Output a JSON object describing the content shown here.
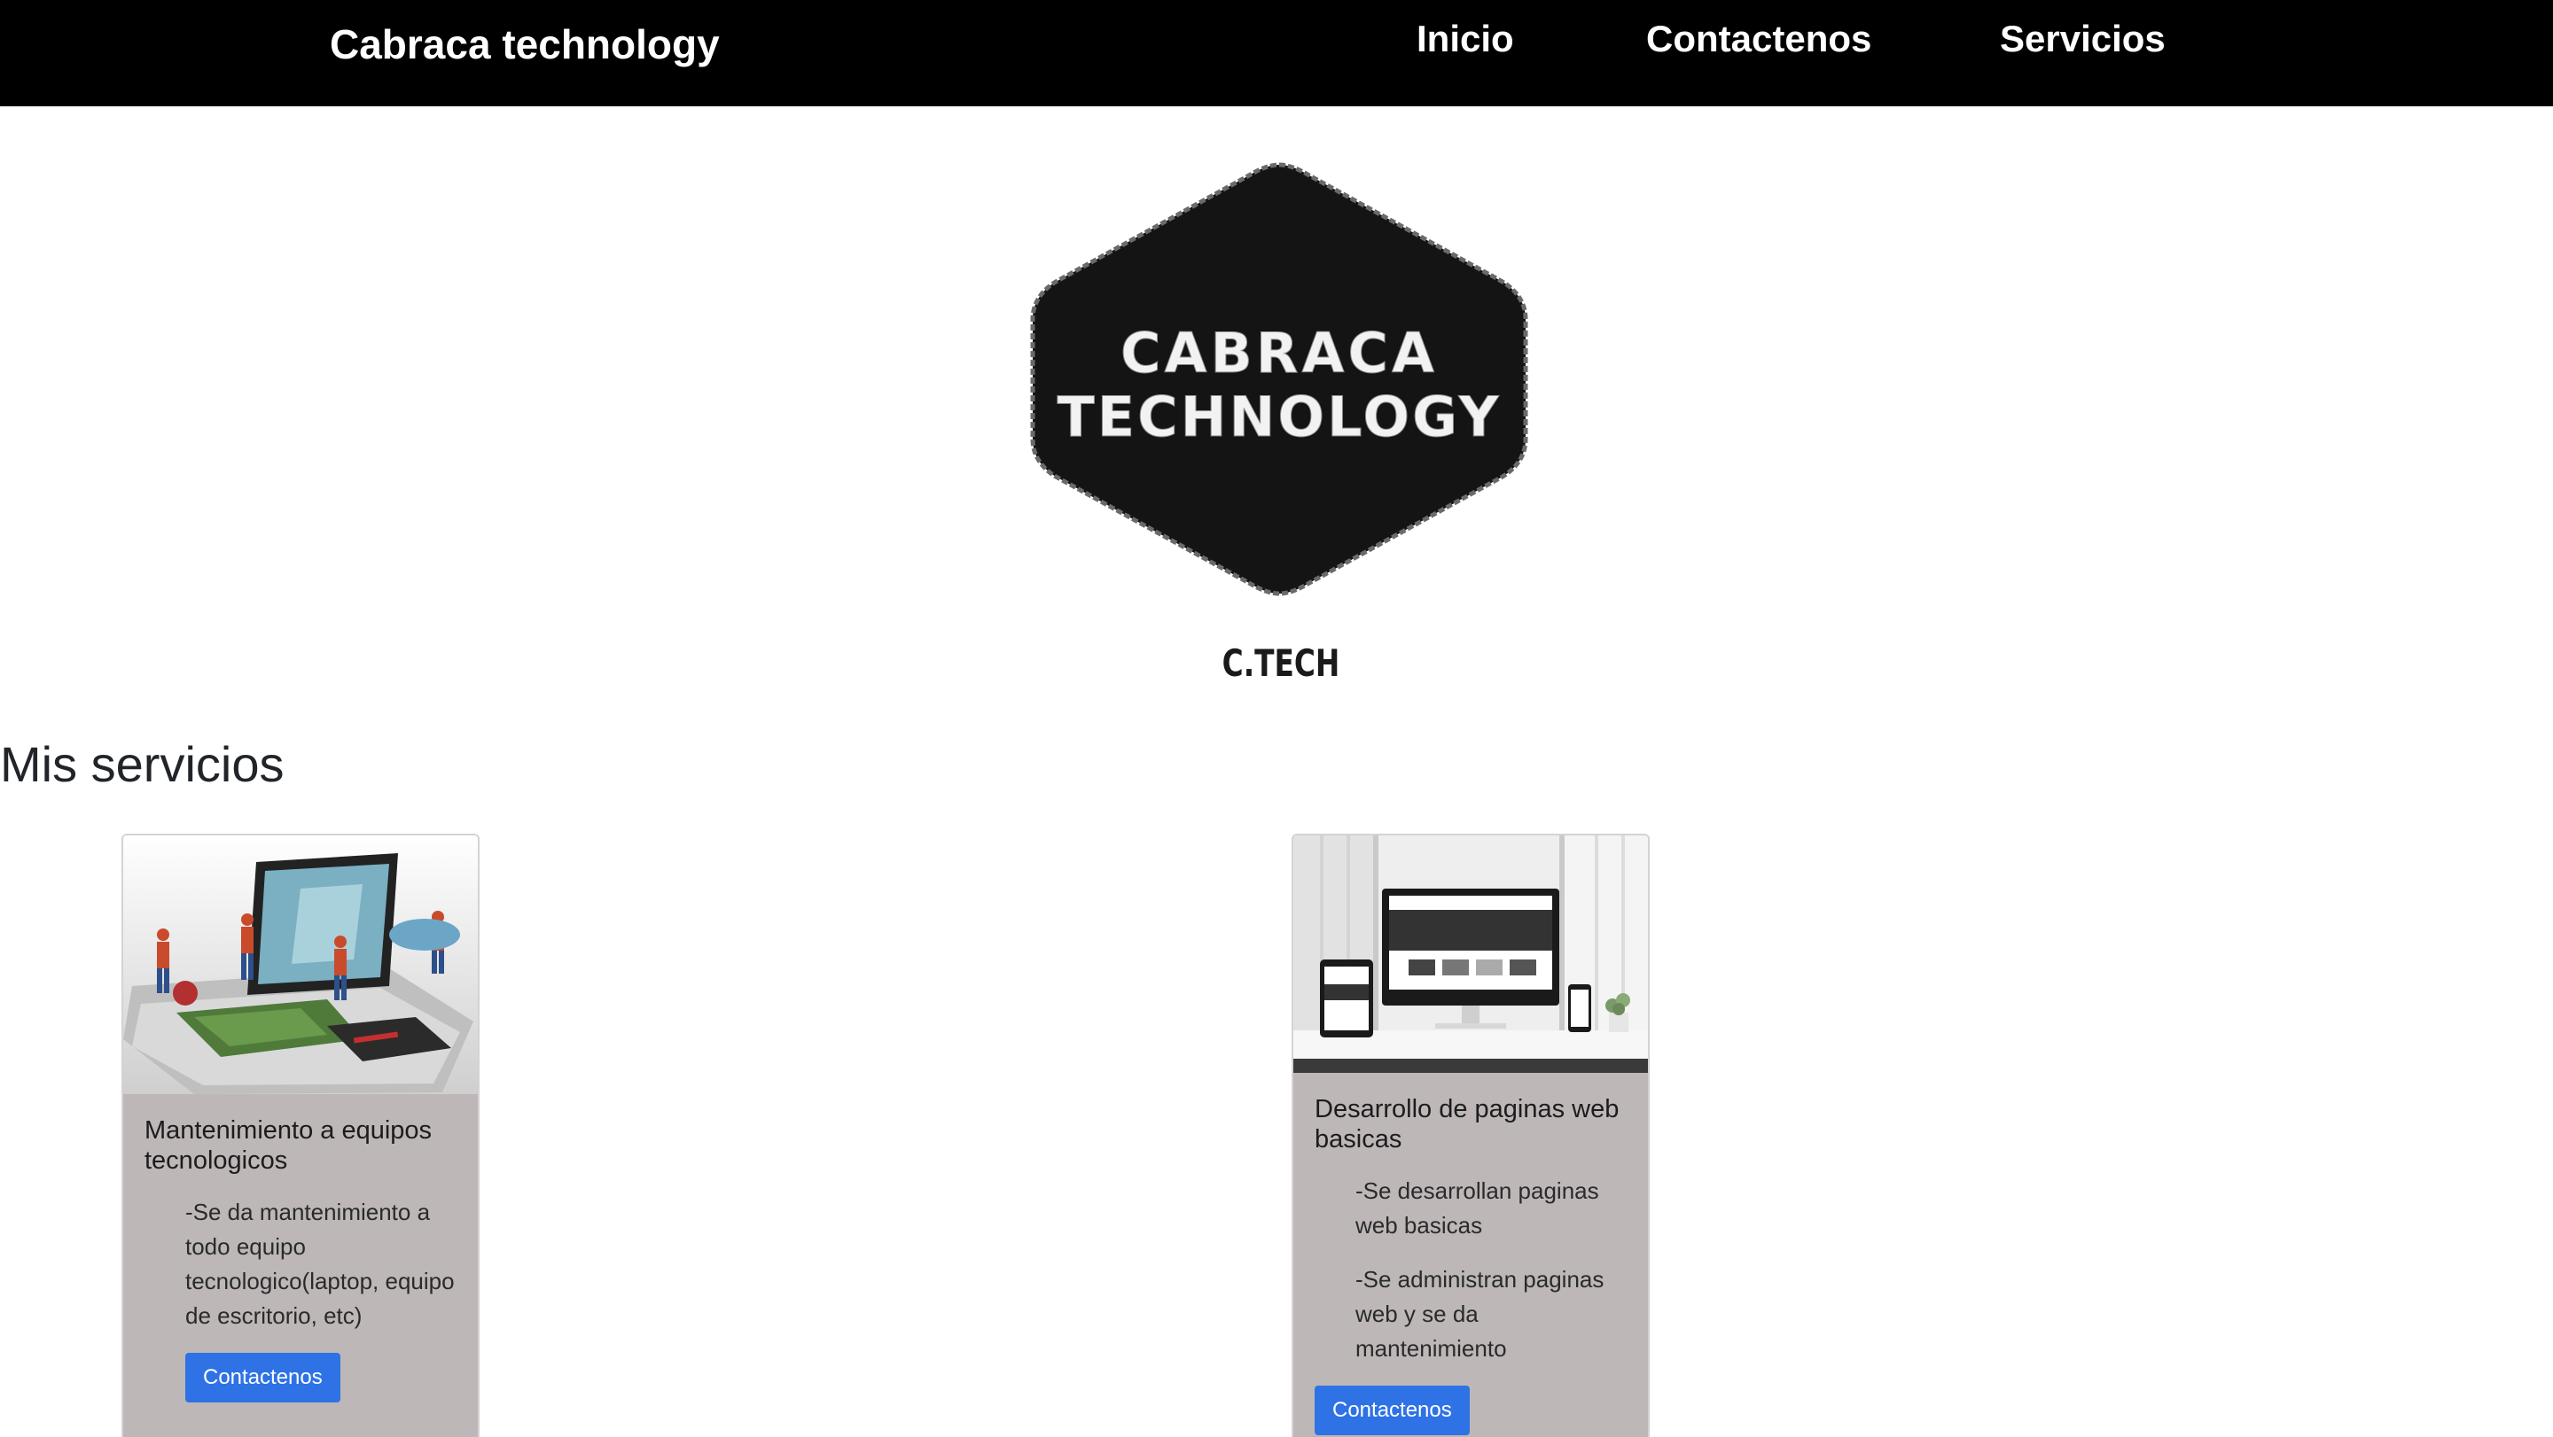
{
  "navbar": {
    "brand": "Cabraca technology",
    "links": [
      {
        "label": "Inicio"
      },
      {
        "label": "Contactenos"
      },
      {
        "label": "Servicios"
      }
    ]
  },
  "logo": {
    "line1": "CABRACA",
    "line2": "TECHNOLOGY",
    "caption": "C.TECH",
    "color": "#141414"
  },
  "services": {
    "title": "Mis servicios",
    "cards": [
      {
        "image": "laptop-repair-illustration",
        "title": "Mantenimiento a equipos tecnologicos",
        "texts": [
          "-Se da mantenimiento a todo equipo tecnologico(laptop, equipo de escritorio, etc)"
        ],
        "button": "Contactenos"
      },
      {
        "image": "web-design-devices-photo",
        "title": "Desarrollo de paginas web basicas",
        "texts": [
          "-Se desarrollan paginas web basicas",
          "-Se administran paginas web y se da mantenimiento"
        ],
        "button": "Contactenos"
      }
    ]
  },
  "colors": {
    "navbar_bg": "#000000",
    "card_bg": "#bdb7b8",
    "button_bg": "#2e72e6"
  }
}
